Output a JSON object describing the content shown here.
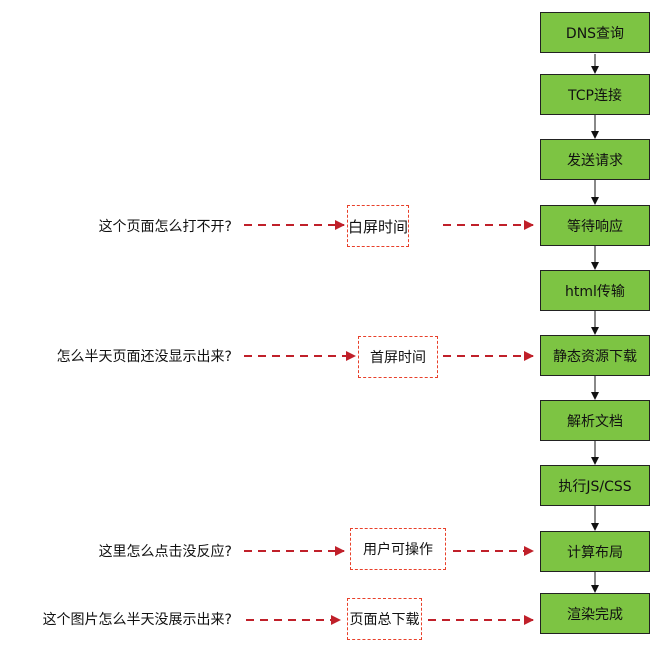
{
  "steps": [
    "DNS查询",
    "TCP连接",
    "发送请求",
    "等待响应",
    "html传输",
    "静态资源下载",
    "解析文档",
    "执行JS/CSS",
    "计算布局",
    "渲染完成"
  ],
  "questions": [
    "这个页面怎么打不开?",
    "怎么半天页面还没显示出来?",
    "这里怎么点击没反应?",
    "这个图片怎么半天没展示出来?"
  ],
  "milestones": [
    "白屏时间",
    "首屏时间",
    "用户可操作",
    "页面总下载"
  ],
  "colors": {
    "step_fill": "#7dc443",
    "dashed_arrow": "#c0202a",
    "milestone_border": "#e8402a"
  }
}
